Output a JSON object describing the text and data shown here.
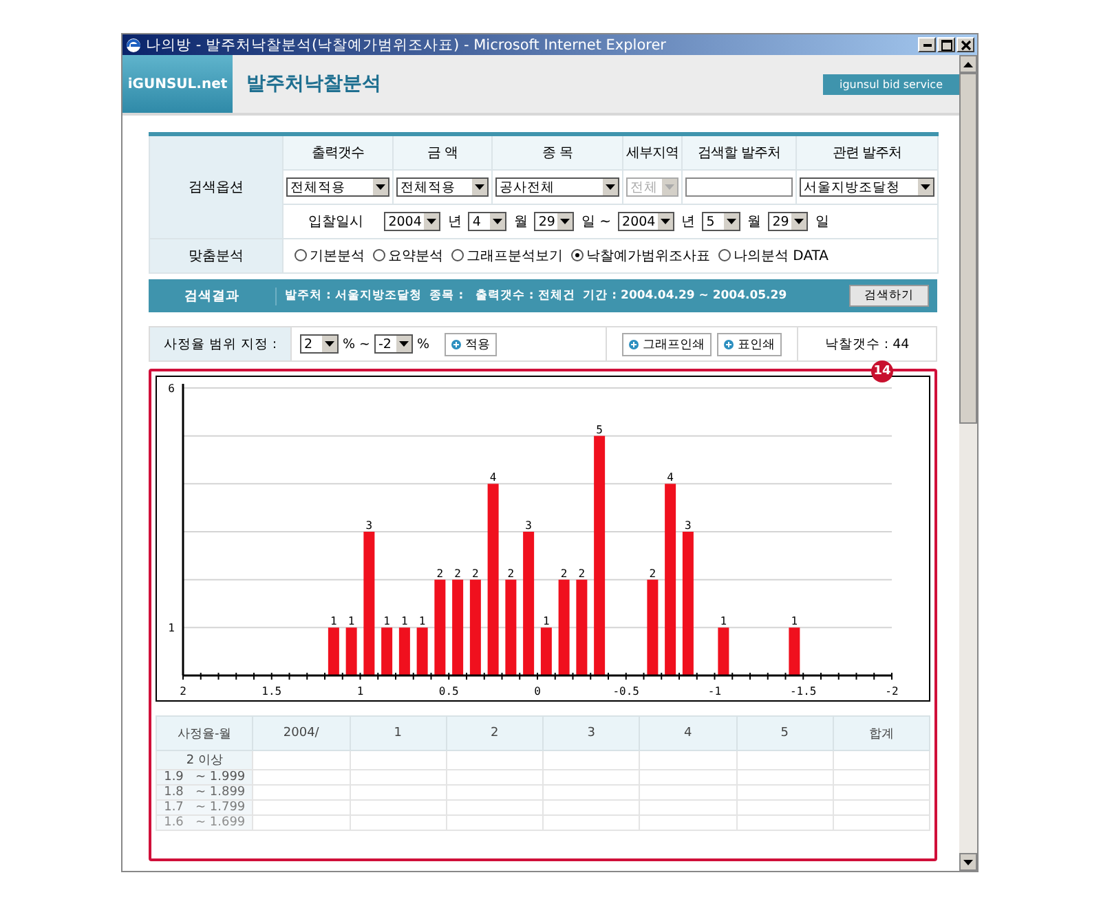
{
  "window": {
    "title": "나의방 - 발주처낙찰분석(낙찰예가범위조사표) - Microsoft Internet Explorer"
  },
  "header": {
    "logo": "iGUNSUL.net",
    "page_title": "발주처낙찰분석",
    "service_badge": "igunsul bid service"
  },
  "search": {
    "section_label": "검색옵션",
    "columns": [
      {
        "heading": "출력갯수",
        "kind": "select",
        "value": "전체적용"
      },
      {
        "heading": "금 액",
        "kind": "select",
        "value": "전체적용"
      },
      {
        "heading": "종 목",
        "kind": "select",
        "value": "공사전체"
      },
      {
        "heading": "세부지역",
        "kind": "select",
        "value": "전체",
        "disabled": true
      },
      {
        "heading": "검색할 발주처",
        "kind": "input"
      },
      {
        "heading": "관련 발주처",
        "kind": "select",
        "value": "서울지방조달청"
      }
    ],
    "date_label": "입찰일시",
    "date_parts": [
      {
        "kind": "select",
        "value": "2004"
      },
      {
        "kind": "unit",
        "text": "년"
      },
      {
        "kind": "select",
        "value": "4"
      },
      {
        "kind": "unit",
        "text": "월"
      },
      {
        "kind": "select",
        "value": "29"
      },
      {
        "kind": "unit",
        "text": "일 ~"
      },
      {
        "kind": "select",
        "value": "2004"
      },
      {
        "kind": "unit",
        "text": "년"
      },
      {
        "kind": "select",
        "value": "5"
      },
      {
        "kind": "unit",
        "text": "월"
      },
      {
        "kind": "select",
        "value": "29"
      },
      {
        "kind": "unit",
        "text": "일"
      }
    ],
    "analysis_label": "맞춤분석",
    "analysis_options": [
      {
        "label": "기본분석",
        "selected": false
      },
      {
        "label": "요약분석",
        "selected": false
      },
      {
        "label": "그래프분석보기",
        "selected": false
      },
      {
        "label": "낙찰예가범위조사표",
        "selected": true
      },
      {
        "label": "나의분석 DATA",
        "selected": false
      }
    ]
  },
  "result_bar": {
    "label": "검색결과",
    "summary": "발주처 : 서울지방조달청  종목 :   출력갯수 : 전체건  기간 : 2004.04.29 ~ 2004.05.29",
    "button": "검색하기"
  },
  "range": {
    "label": "사정율 범위 지정 :",
    "from": "2",
    "from_unit": "%",
    "separator": "~",
    "to": "-2",
    "to_unit": "%",
    "apply": "적용",
    "print_buttons": [
      "그래프인쇄",
      "표인쇄"
    ],
    "count": "낙찰갯수 : 44"
  },
  "chart_panel": {
    "marker": "14",
    "chart_data": {
      "type": "bar",
      "x": [
        1.15,
        1.05,
        0.95,
        0.85,
        0.75,
        0.65,
        0.55,
        0.45,
        0.35,
        0.25,
        0.15,
        0.05,
        -0.05,
        -0.15,
        -0.25,
        -0.35,
        -0.65,
        -0.75,
        -0.85,
        -1.05,
        -1.45
      ],
      "values": [
        1,
        1,
        3,
        1,
        1,
        1,
        2,
        2,
        2,
        4,
        2,
        3,
        1,
        2,
        2,
        5,
        2,
        4,
        3,
        1,
        1
      ],
      "xlim": [
        2,
        -2
      ],
      "ylim": [
        0,
        6
      ],
      "xticks": [
        {
          "value": 2,
          "label": "2"
        },
        {
          "value": 1.5,
          "label": "1.5"
        },
        {
          "value": 1,
          "label": "1"
        },
        {
          "value": 0.5,
          "label": "0.5"
        },
        {
          "value": 0,
          "label": "0"
        },
        {
          "value": -0.5,
          "label": "-0.5"
        },
        {
          "value": -1,
          "label": "-1"
        },
        {
          "value": -1.5,
          "label": "-1.5"
        },
        {
          "value": -2,
          "label": "-2"
        }
      ],
      "yticks": [
        1,
        6
      ],
      "data_labels": true
    }
  },
  "table": {
    "columns": [
      "사정율-월",
      "2004/",
      "1",
      "2",
      "3",
      "4",
      "5",
      "합계"
    ],
    "rows": [
      {
        "label": "2 이상"
      },
      {
        "label": "1.9   ~ 1.999"
      },
      {
        "label": "1.8   ~ 1.899"
      },
      {
        "label": "1.7   ~ 1.799"
      },
      {
        "label": "1.6   ~ 1.699"
      }
    ]
  }
}
